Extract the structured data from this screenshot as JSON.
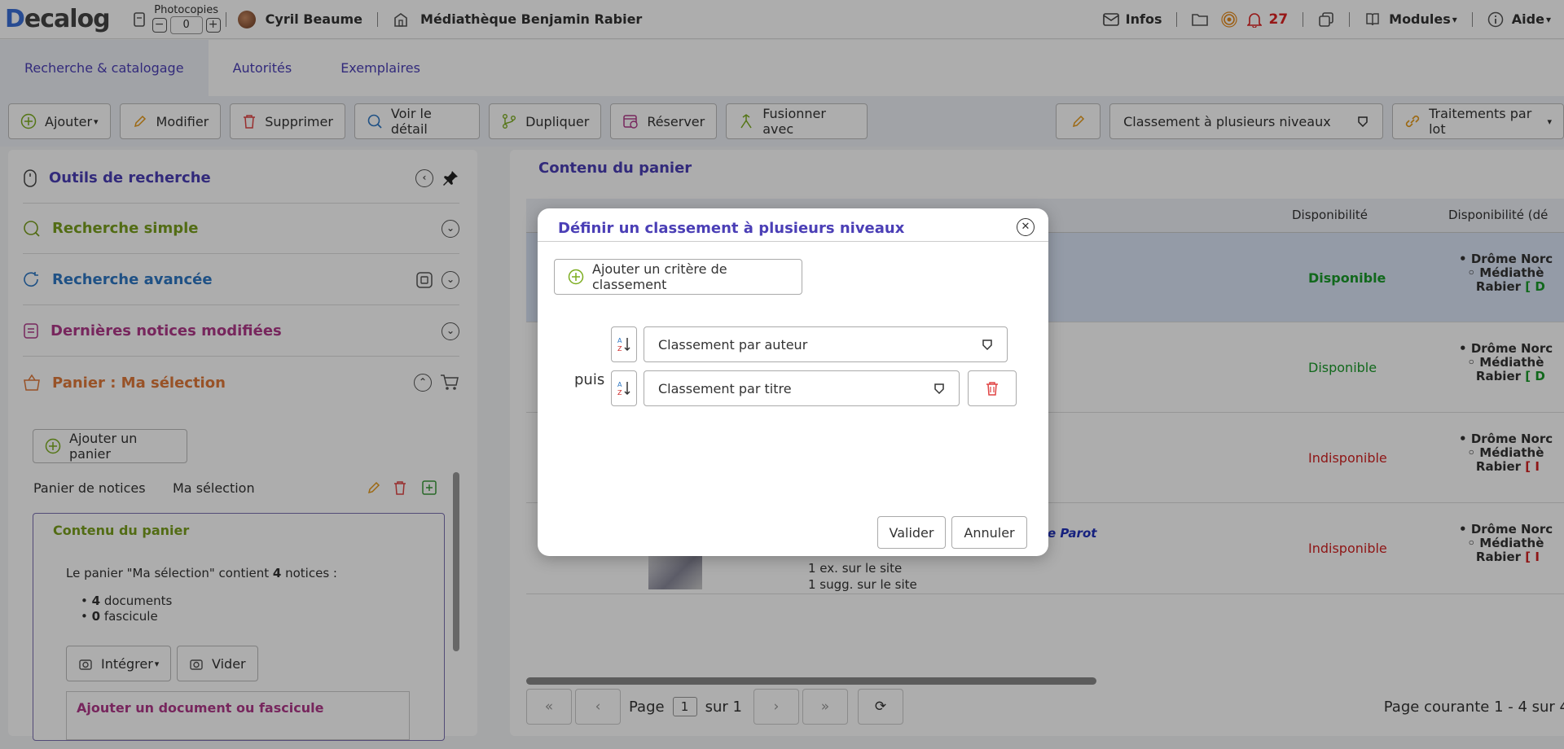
{
  "topbar": {
    "logo_first": "D",
    "logo_rest": "ecalog",
    "photocopies_label": "Photocopies",
    "photocopies_value": "0",
    "minus": "−",
    "plus": "+",
    "user_name": "Cyril Beaume",
    "library_name": "Médiathèque Benjamin Rabier",
    "infos_label": "Infos",
    "notifications_count": "27",
    "modules_label": "Modules",
    "help_label": "Aide"
  },
  "tabs": [
    {
      "label": "Recherche & catalogage"
    },
    {
      "label": "Autorités"
    },
    {
      "label": "Exemplaires"
    }
  ],
  "toolbar": {
    "add": "Ajouter",
    "edit": "Modifier",
    "delete": "Supprimer",
    "detail": "Voir le détail",
    "duplicate": "Dupliquer",
    "reserve": "Réserver",
    "merge": "Fusionner avec",
    "sort_select": "Classement à plusieurs niveaux",
    "batch": "Traitements par lot"
  },
  "sidebar": {
    "search_tools": "Outils de recherche",
    "simple_search": "Recherche simple",
    "advanced_search": "Recherche avancée",
    "recent_records": "Dernières notices modifiées",
    "cart": "Panier : Ma sélection",
    "add_cart": "Ajouter un panier",
    "cart_type": "Panier de notices",
    "cart_name": "Ma sélection",
    "cart_content_title": "Contenu du panier",
    "cart_desc_prefix": "Le panier \"Ma sélection\" contient ",
    "cart_count": "4",
    "cart_desc_suffix": " notices :",
    "docs_count": "4",
    "docs_label": " documents",
    "fasc_count": "0",
    "fasc_label": " fascicule",
    "integrate": "Intégrer",
    "empty": "Vider",
    "add_doc": "Ajouter un document ou fascicule"
  },
  "main": {
    "title": "Contenu du panier",
    "col_availability": "Disponibilité",
    "col_availability2": "Disponibilité (dé",
    "rows": [
      {
        "status": "Disponible",
        "status_color": "#1a9a2a",
        "bold": true
      },
      {
        "status": "Disponible",
        "status_color": "#1a9a2a",
        "bold": false
      },
      {
        "status": "Indisponible",
        "status_color": "#d22222",
        "bold": false
      },
      {
        "status": "Indisponible",
        "status_color": "#d22222",
        "bold": false
      }
    ],
    "loc_line1": "Drôme Norc",
    "loc_line2": "Médiathè",
    "loc_line3": "Rabier",
    "loc_green": "[ D",
    "loc_red": "[ I",
    "row4_author": "e Parot",
    "row4_line1": "1 ex. sur le site",
    "row4_line2": "1 sugg. sur le site",
    "pager_page": "Page",
    "pager_value": "1",
    "pager_of": "sur 1",
    "pager_status": "Page courante 1 - 4 sur 4"
  },
  "modal": {
    "title": "Définir un classement à plusieurs niveaux",
    "add_criterion": "Ajouter un critère de classement",
    "then_label": "puis",
    "criterion1": "Classement par auteur",
    "criterion2": "Classement par titre",
    "validate": "Valider",
    "cancel": "Annuler"
  }
}
